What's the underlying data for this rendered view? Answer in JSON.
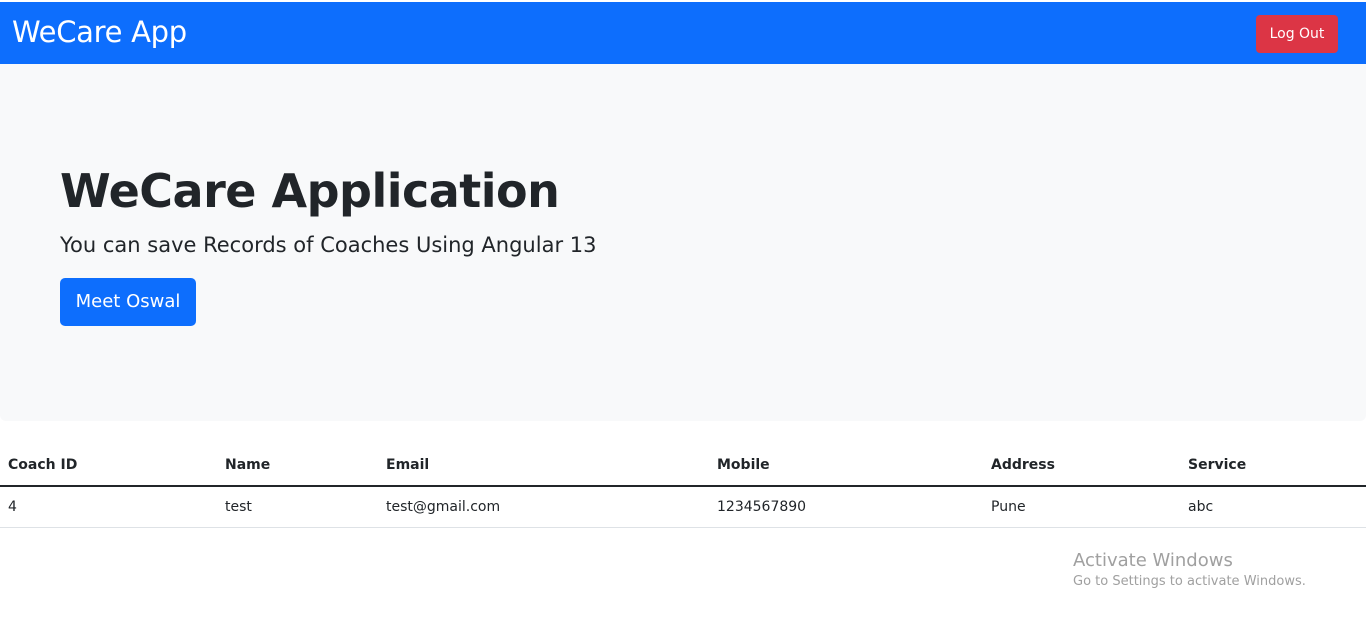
{
  "navbar": {
    "brand": "WeCare App",
    "logout_label": "Log Out",
    "background": "#0d6efd",
    "logout_color": "#dc3545"
  },
  "hero": {
    "title": "WeCare Application",
    "lead": "You can save Records of Coaches Using Angular 13",
    "button_label": "Meet Oswal"
  },
  "table": {
    "columns": [
      "Coach ID",
      "Name",
      "Email",
      "Mobile",
      "Address",
      "Service"
    ],
    "rows": [
      [
        "4",
        "test",
        "test@gmail.com",
        "1234567890",
        "Pune",
        "abc"
      ]
    ]
  },
  "watermark": {
    "title": "Activate Windows",
    "subtitle": "Go to Settings to activate Windows."
  }
}
